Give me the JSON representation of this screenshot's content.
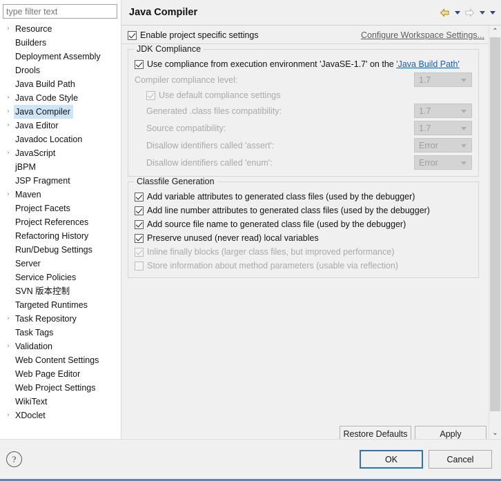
{
  "sidebar": {
    "filter_placeholder": "type filter text",
    "items": [
      {
        "label": "Resource",
        "expandable": true,
        "selected": false
      },
      {
        "label": "Builders",
        "expandable": false,
        "selected": false
      },
      {
        "label": "Deployment Assembly",
        "expandable": false,
        "selected": false
      },
      {
        "label": "Drools",
        "expandable": false,
        "selected": false
      },
      {
        "label": "Java Build Path",
        "expandable": false,
        "selected": false
      },
      {
        "label": "Java Code Style",
        "expandable": true,
        "selected": false
      },
      {
        "label": "Java Compiler",
        "expandable": true,
        "selected": true
      },
      {
        "label": "Java Editor",
        "expandable": true,
        "selected": false
      },
      {
        "label": "Javadoc Location",
        "expandable": false,
        "selected": false
      },
      {
        "label": "JavaScript",
        "expandable": true,
        "selected": false
      },
      {
        "label": "jBPM",
        "expandable": false,
        "selected": false
      },
      {
        "label": "JSP Fragment",
        "expandable": false,
        "selected": false
      },
      {
        "label": "Maven",
        "expandable": true,
        "selected": false
      },
      {
        "label": "Project Facets",
        "expandable": false,
        "selected": false
      },
      {
        "label": "Project References",
        "expandable": false,
        "selected": false
      },
      {
        "label": "Refactoring History",
        "expandable": false,
        "selected": false
      },
      {
        "label": "Run/Debug Settings",
        "expandable": false,
        "selected": false
      },
      {
        "label": "Server",
        "expandable": false,
        "selected": false
      },
      {
        "label": "Service Policies",
        "expandable": false,
        "selected": false
      },
      {
        "label": "SVN 版本控制",
        "expandable": false,
        "selected": false
      },
      {
        "label": "Targeted Runtimes",
        "expandable": false,
        "selected": false
      },
      {
        "label": "Task Repository",
        "expandable": true,
        "selected": false
      },
      {
        "label": "Task Tags",
        "expandable": false,
        "selected": false
      },
      {
        "label": "Validation",
        "expandable": true,
        "selected": false
      },
      {
        "label": "Web Content Settings",
        "expandable": false,
        "selected": false
      },
      {
        "label": "Web Page Editor",
        "expandable": false,
        "selected": false
      },
      {
        "label": "Web Project Settings",
        "expandable": false,
        "selected": false
      },
      {
        "label": "WikiText",
        "expandable": false,
        "selected": false
      },
      {
        "label": "XDoclet",
        "expandable": true,
        "selected": false
      }
    ]
  },
  "page": {
    "title": "Java Compiler",
    "enable_project_specific": {
      "label": "Enable project specific settings",
      "checked": true
    },
    "configure_workspace_link": "Configure Workspace Settings...",
    "jdk_compliance": {
      "title": "JDK Compliance",
      "use_execution_env": {
        "label_prefix": "Use compliance from execution environment 'JavaSE-1.7' on the ",
        "link": "'Java Build Path'",
        "checked": true
      },
      "compiler_compliance_level": {
        "label": "Compiler compliance level:",
        "value": "1.7",
        "disabled": true
      },
      "use_default_compliance": {
        "label": "Use default compliance settings",
        "checked": true,
        "disabled": true
      },
      "generated_class_compat": {
        "label": "Generated .class files compatibility:",
        "value": "1.7",
        "disabled": true
      },
      "source_compat": {
        "label": "Source compatibility:",
        "value": "1.7",
        "disabled": true
      },
      "disallow_assert": {
        "label": "Disallow identifiers called 'assert':",
        "value": "Error",
        "disabled": true
      },
      "disallow_enum": {
        "label": "Disallow identifiers called 'enum':",
        "value": "Error",
        "disabled": true
      }
    },
    "classfile_generation": {
      "title": "Classfile Generation",
      "options": [
        {
          "label": "Add variable attributes to generated class files (used by the debugger)",
          "checked": true,
          "disabled": false
        },
        {
          "label": "Add line number attributes to generated class files (used by the debugger)",
          "checked": true,
          "disabled": false
        },
        {
          "label": "Add source file name to generated class file (used by the debugger)",
          "checked": true,
          "disabled": false
        },
        {
          "label": "Preserve unused (never read) local variables",
          "checked": true,
          "disabled": false
        },
        {
          "label": "Inline finally blocks (larger class files, but improved performance)",
          "checked": true,
          "disabled": true
        },
        {
          "label": "Store information about method parameters (usable via reflection)",
          "checked": false,
          "disabled": true
        }
      ]
    },
    "restore_defaults_label": "Restore Defaults",
    "apply_label": "Apply"
  },
  "footer": {
    "help_glyph": "?",
    "ok_label": "OK",
    "cancel_label": "Cancel"
  },
  "icons": {
    "back_arrow": "back-arrow-icon",
    "forward_arrow": "forward-arrow-icon",
    "scroll_up": "⌃",
    "scroll_down": "⌄",
    "collapse_up": "⌃"
  }
}
